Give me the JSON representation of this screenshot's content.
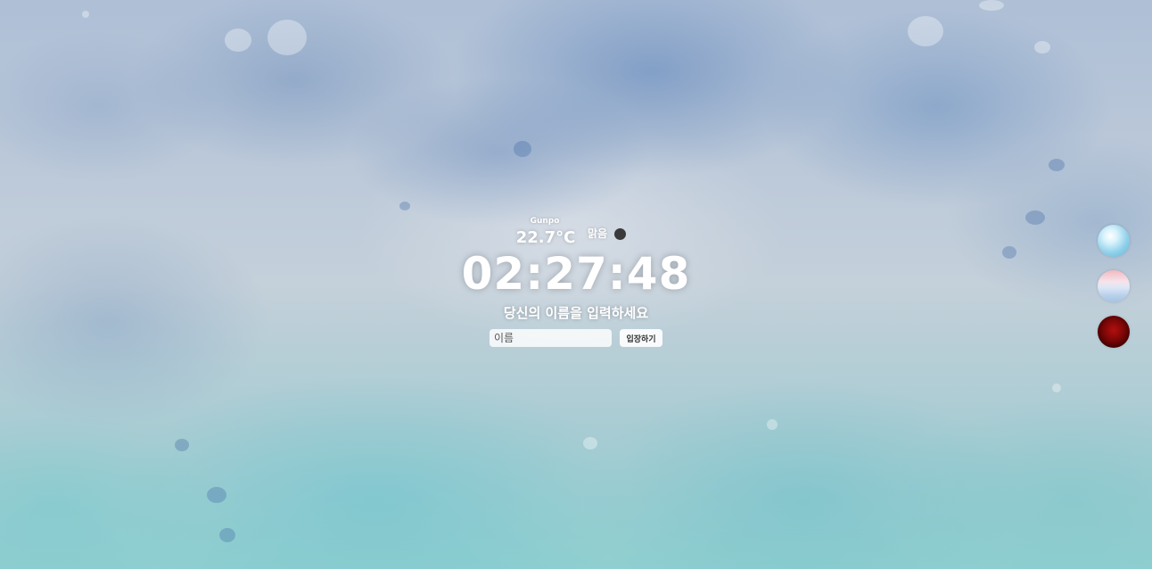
{
  "weather": {
    "city": "Gunpo",
    "temperature": "22.7°C",
    "description": "맑음",
    "icon": "clear-night-icon"
  },
  "clock": {
    "time": "02:27:48"
  },
  "greeting": {
    "prompt": "당신의 이름을 입력하세요",
    "input_placeholder": "이름",
    "input_value": "",
    "enter_label": "입장하기"
  },
  "themes": [
    {
      "name": "sky",
      "accent": "#8fd0ea"
    },
    {
      "name": "pink",
      "accent": "#f2b8c0"
    },
    {
      "name": "red",
      "accent": "#7a0606"
    }
  ]
}
